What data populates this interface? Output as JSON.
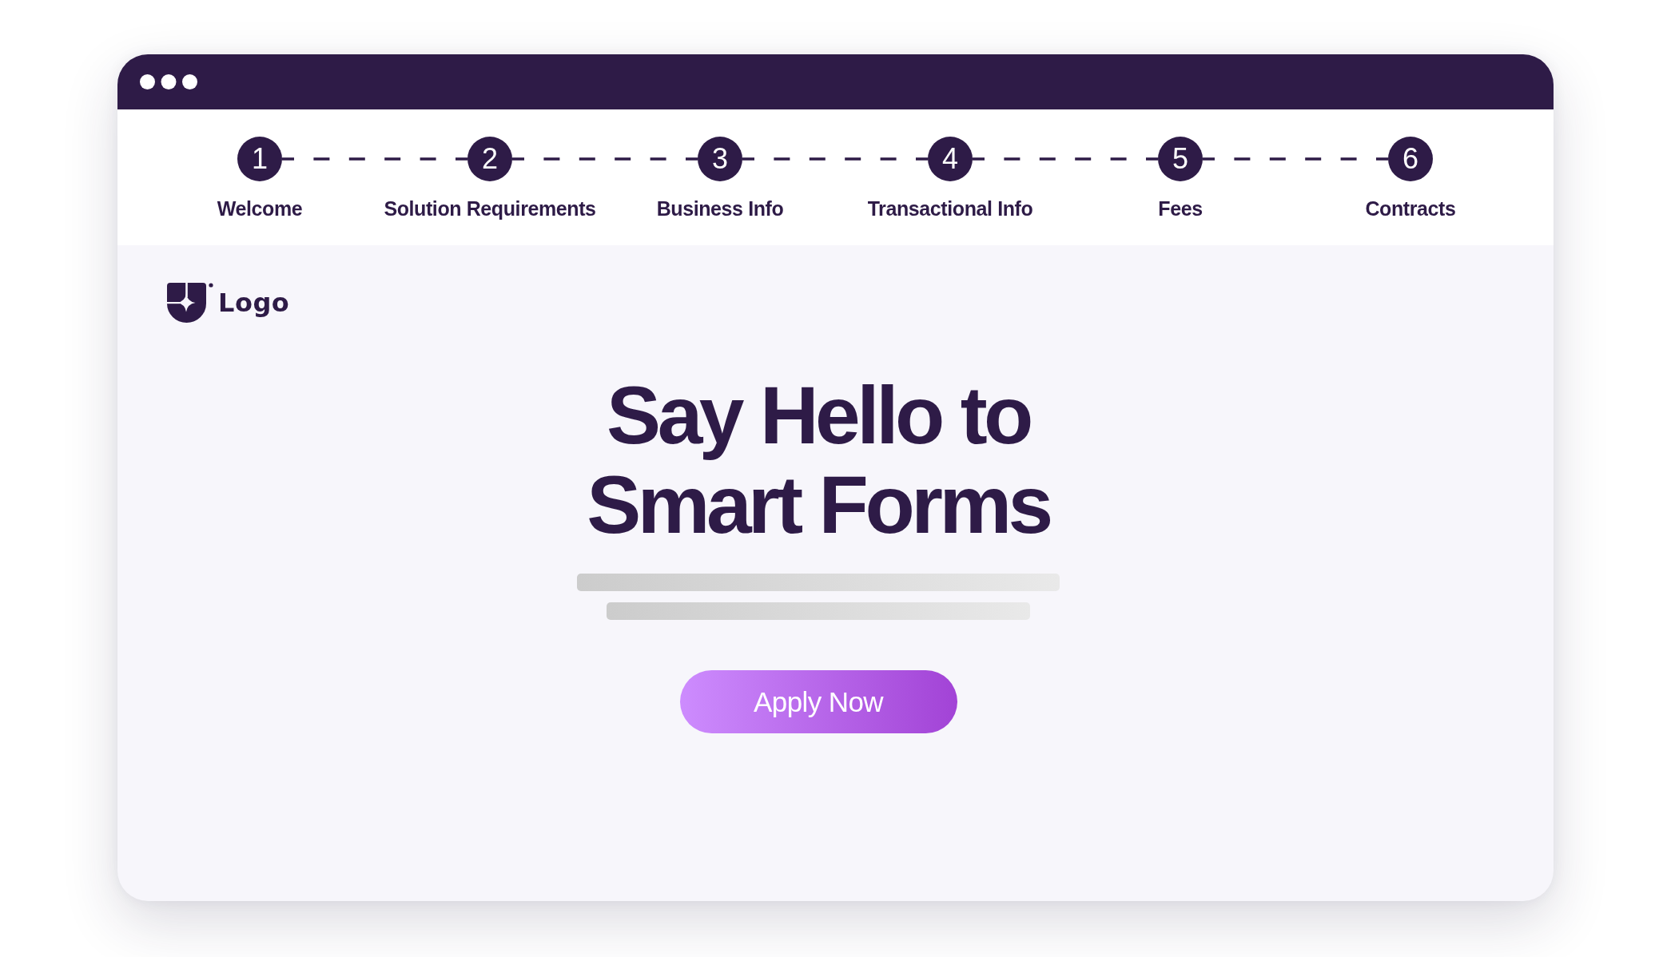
{
  "stepper": {
    "steps": [
      {
        "number": "1",
        "label": "Welcome"
      },
      {
        "number": "2",
        "label": "Solution Requirements"
      },
      {
        "number": "3",
        "label": "Business Info"
      },
      {
        "number": "4",
        "label": "Transactional Info"
      },
      {
        "number": "5",
        "label": "Fees"
      },
      {
        "number": "6",
        "label": "Contracts"
      }
    ]
  },
  "logo": {
    "text": "Logo"
  },
  "hero": {
    "headline": "Say Hello to Smart Forms",
    "button": {
      "label": "Apply Now"
    }
  }
}
